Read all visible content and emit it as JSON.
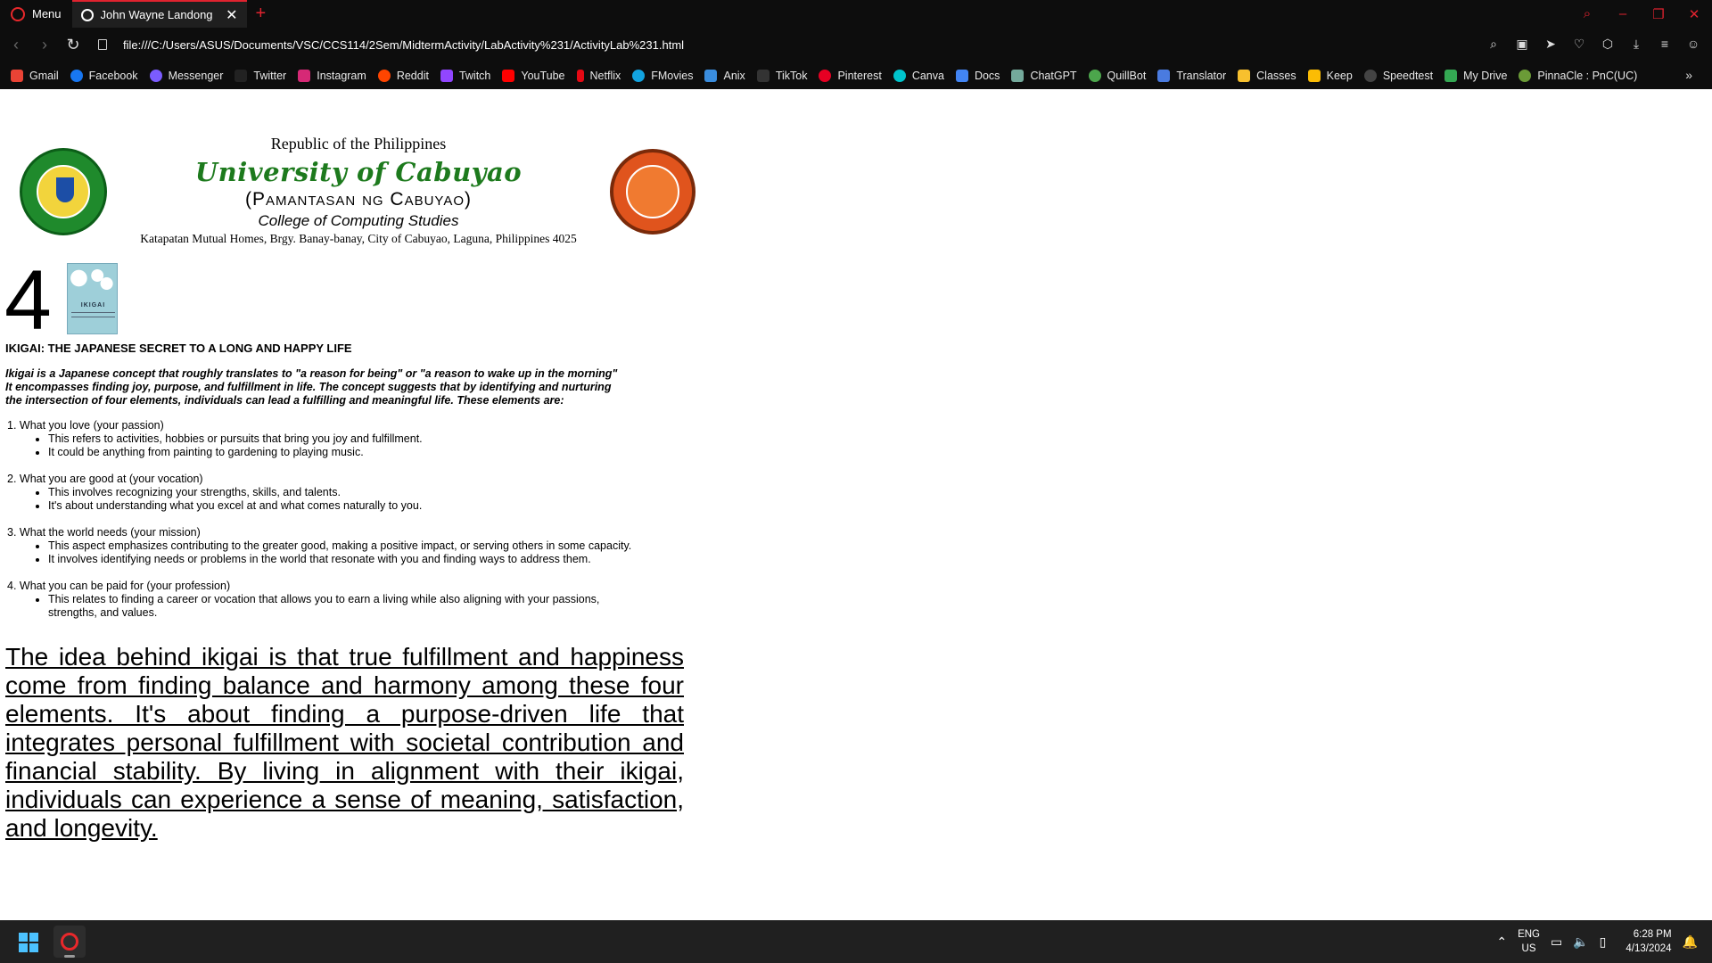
{
  "browser": {
    "menu_label": "Menu",
    "tab_title": "John Wayne Landong",
    "url": "file:///C:/Users/ASUS/Documents/VSC/CCS114/2Sem/MidtermActivity/LabActivity%231/ActivityLab%231.html",
    "accent": "#e0232f",
    "bookmarks": [
      "Gmail",
      "Facebook",
      "Messenger",
      "Twitter",
      "Instagram",
      "Reddit",
      "Twitch",
      "YouTube",
      "Netflix",
      "FMovies",
      "Anix",
      "TikTok",
      "Pinterest",
      "Canva",
      "Docs",
      "ChatGPT",
      "QuillBot",
      "Translator",
      "Classes",
      "Keep",
      "Speedtest",
      "My Drive",
      "PinnaCle : PnC(UC)"
    ]
  },
  "letterhead": {
    "republic": "Republic of the Philippines",
    "university": "University of Cabuyao",
    "pamantasan": "(Pamantasan ng Cabuyao)",
    "college": "College of Computing Studies",
    "address": "Katapatan Mutual Homes, Brgy. Banay-banay, City of Cabuyao, Laguna, Philippines 4025"
  },
  "content": {
    "number": "4",
    "book_title": "IKIGAI",
    "heading": "IKIGAI: THE JAPANESE SECRET TO A LONG AND HAPPY LIFE",
    "intro_lines": [
      "Ikigai is a Japanese concept that roughly translates to \"a reason for being\" or \"a reason to wake up in the morning\"",
      "It encompasses finding joy, purpose, and fulfillment in life. The concept suggests that by identifying and nurturing",
      "the intersection of four elements, individuals can lead a fulfilling and meaningful life. These elements are:"
    ],
    "items": [
      {
        "title": "1. What you love (your passion)",
        "bullets": [
          "This refers to activities, hobbies or pursuits that bring you joy and fulfillment.",
          "It could be anything from painting to gardening to playing music."
        ]
      },
      {
        "title": "2. What you are good at (your vocation)",
        "bullets": [
          "This involves recognizing your strengths, skills, and talents.",
          "It's about understanding what you excel at and what comes naturally to you."
        ]
      },
      {
        "title": "3. What the world needs (your mission)",
        "bullets": [
          "This aspect emphasizes contributing to the greater good, making a positive impact, or serving others in some capacity.",
          "It involves identifying needs or problems in the world that resonate with you and finding ways to address them."
        ]
      },
      {
        "title": "4. What you can be paid for (your profession)",
        "bullets": [
          "This relates to finding a career or vocation that allows you to earn a living while also aligning with your passions, strengths, and values."
        ]
      }
    ],
    "conclusion": "The idea behind ikigai is that true fulfillment and happiness come from finding balance and harmony among these four elements. It's about finding a purpose-driven life that integrates personal fulfillment with societal contribution and financial stability. By living in alignment with their ikigai, individuals can experience a sense of meaning, satisfaction, and longevity."
  },
  "taskbar": {
    "lang_1": "ENG",
    "lang_2": "US",
    "time": "6:28 PM",
    "date": "4/13/2024"
  }
}
